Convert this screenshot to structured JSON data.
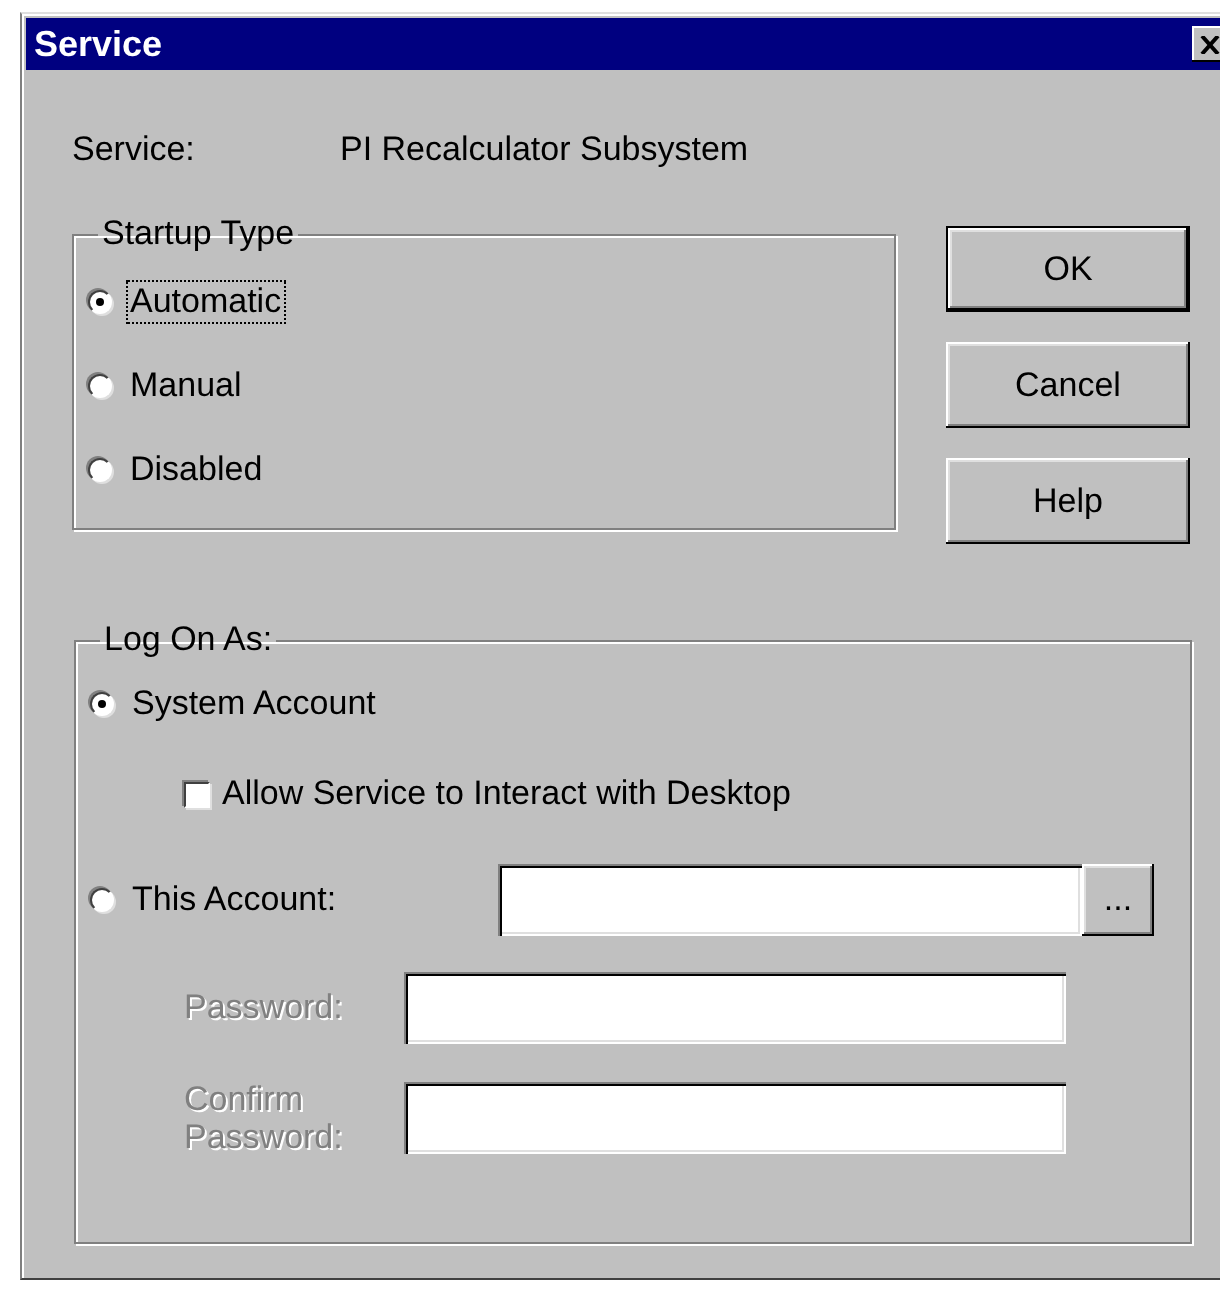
{
  "window": {
    "title": "Service"
  },
  "service": {
    "label": "Service:",
    "value": "PI Recalculator Subsystem"
  },
  "startup_type": {
    "title": "Startup Type",
    "options": [
      {
        "label": "Automatic",
        "selected": true,
        "focused": true
      },
      {
        "label": "Manual",
        "selected": false,
        "focused": false
      },
      {
        "label": "Disabled",
        "selected": false,
        "focused": false
      }
    ]
  },
  "buttons": [
    {
      "label": "OK",
      "default": true
    },
    {
      "label": "Cancel",
      "default": false
    },
    {
      "label": "Help",
      "default": false
    }
  ],
  "log_on_as": {
    "title": "Log On As:",
    "system_account": {
      "label": "System Account",
      "selected": true
    },
    "interact_desktop": {
      "label": "Allow Service to Interact with Desktop",
      "checked": false
    },
    "this_account": {
      "label": "This Account:",
      "selected": false,
      "browse_button": "..."
    },
    "password": {
      "label": "Password:",
      "disabled": true
    },
    "confirm_password": {
      "label": "Confirm Password:",
      "disabled": true
    }
  }
}
